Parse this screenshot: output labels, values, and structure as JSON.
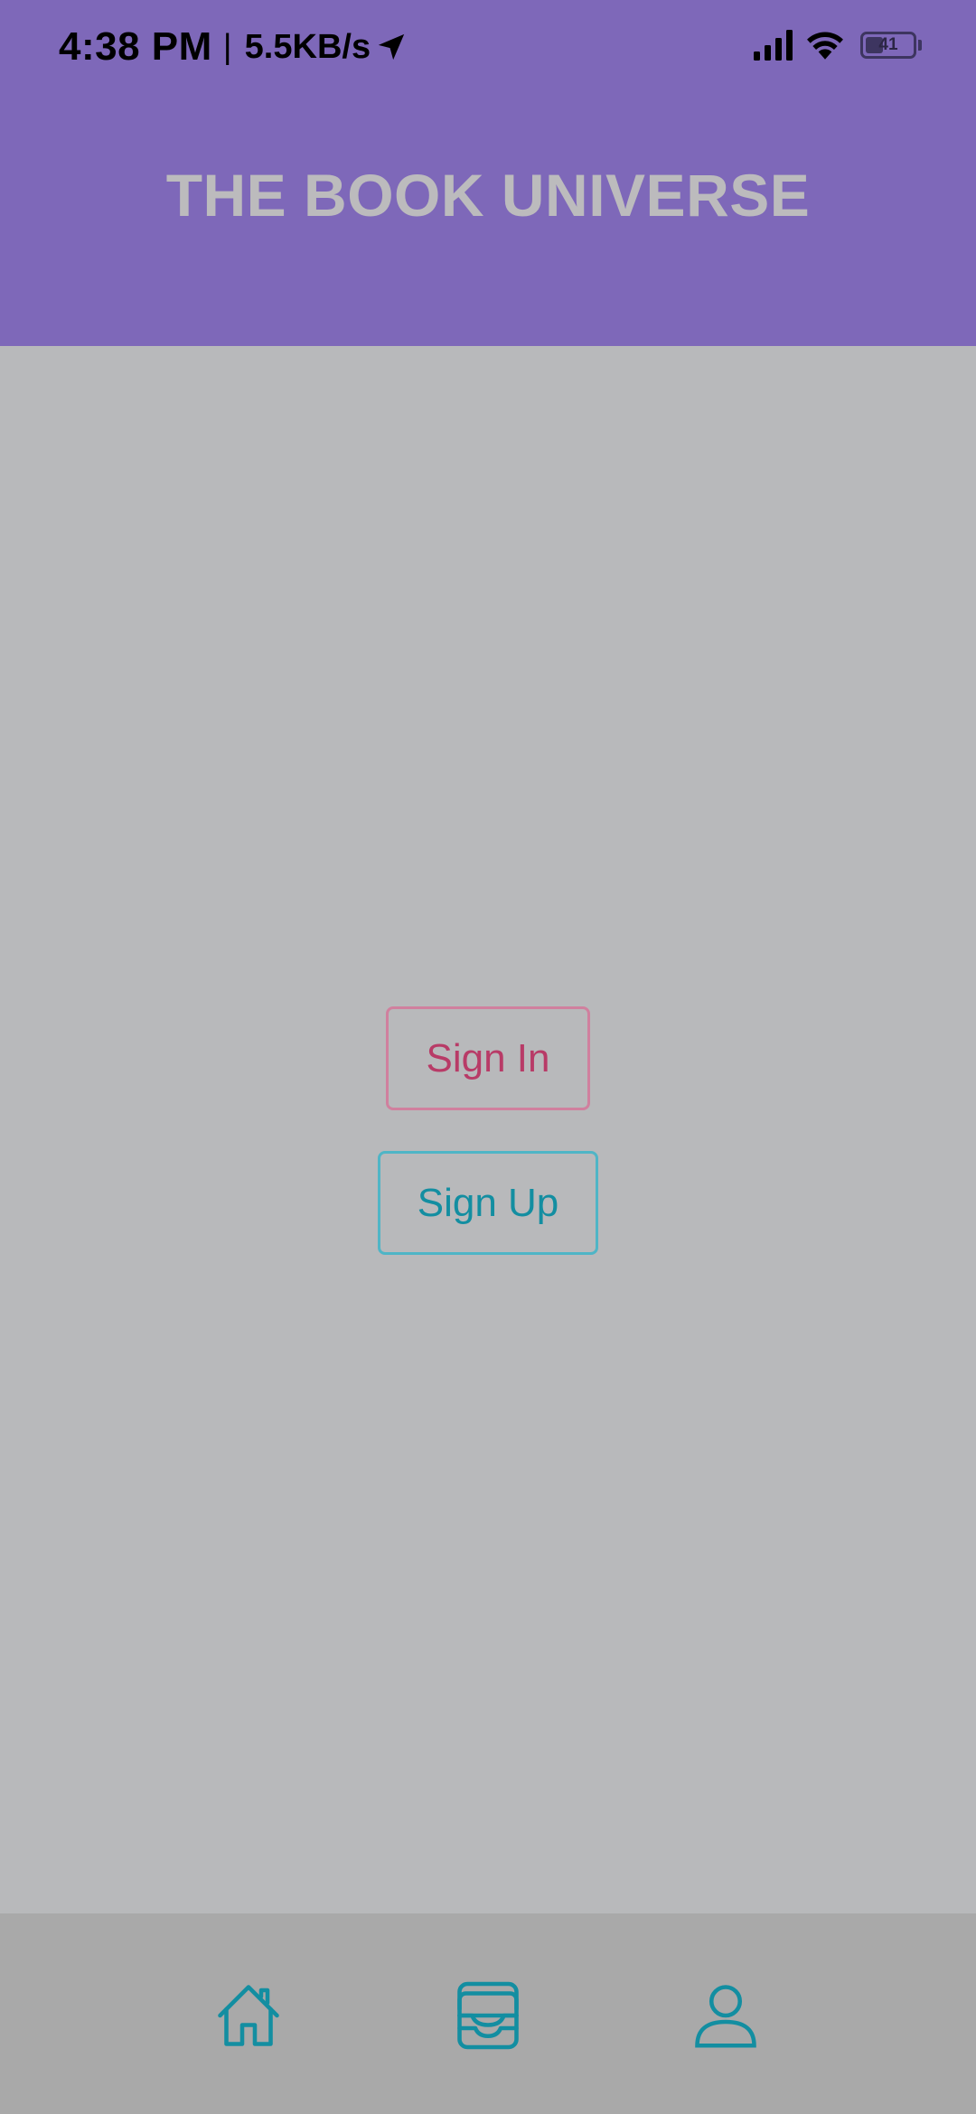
{
  "status_bar": {
    "time": "4:38 PM",
    "separator": "|",
    "network_speed": "5.5KB/s",
    "battery_level": "41",
    "icons": [
      "location-arrow-icon",
      "signal-icon",
      "wifi-icon",
      "battery-icon"
    ]
  },
  "header": {
    "title": "THE BOOK UNIVERSE"
  },
  "main": {
    "sign_in_label": "Sign In",
    "sign_up_label": "Sign Up"
  },
  "bottom_nav": {
    "items": [
      {
        "icon": "home-icon"
      },
      {
        "icon": "inbox-icon"
      },
      {
        "icon": "profile-icon"
      }
    ]
  },
  "colors": {
    "header_bg": "#7e68b9",
    "content_bg": "#b8b9bb",
    "nav_bg": "#a9a9a9",
    "sign_in_accent": "#b83b67",
    "sign_up_accent": "#138ea1",
    "title_text": "#bcbbbd"
  }
}
